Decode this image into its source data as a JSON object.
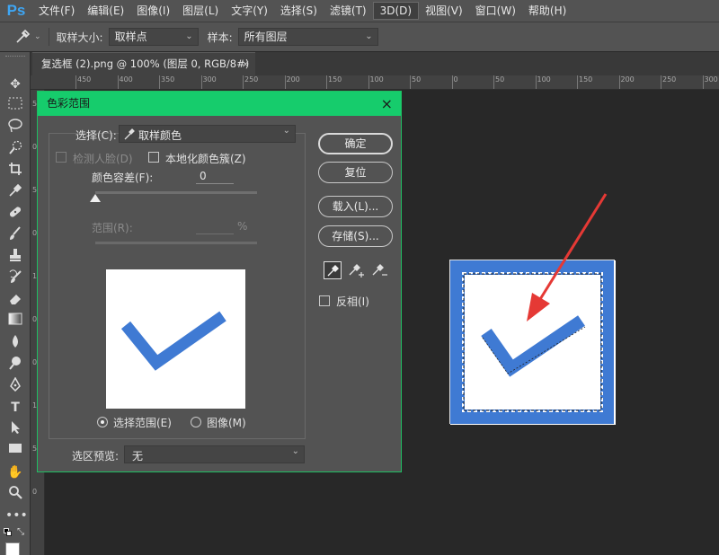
{
  "app": {
    "logo": "Ps",
    "accent": "#16cc6c"
  },
  "menu": [
    "文件(F)",
    "编辑(E)",
    "图像(I)",
    "图层(L)",
    "文字(Y)",
    "选择(S)",
    "滤镜(T)",
    "3D(D)",
    "视图(V)",
    "窗口(W)",
    "帮助(H)"
  ],
  "options": {
    "tool_icon": "eyedropper-icon",
    "sample_size_label": "取样大小:",
    "sample_size_value": "取样点",
    "sample_label": "样本:",
    "sample_value": "所有图层"
  },
  "document": {
    "tab_title": "复选框 (2).png @ 100% (图层 0, RGB/8#) *",
    "close": "×"
  },
  "ruler": {
    "top_ticks": [
      "450",
      "400",
      "350",
      "300",
      "250",
      "200",
      "150",
      "100",
      "50",
      "0",
      "50",
      "100",
      "150",
      "200",
      "250",
      "300",
      "350"
    ],
    "left_ticks": [
      "5",
      "0",
      "5",
      "0",
      "1",
      "0",
      "0",
      "1",
      "5",
      "0"
    ]
  },
  "dialog": {
    "title": "色彩范围",
    "close": "×",
    "select_label": "选择(C):",
    "select_value": "取样颜色",
    "detect_faces": "检测人脸(D)",
    "localized_clusters": "本地化颜色簇(Z)",
    "fuzziness_label": "颜色容差(F):",
    "fuzziness_value": "0",
    "range_label": "范围(R):",
    "range_unit": "%",
    "radio_selection": "选择范围(E)",
    "radio_image": "图像(M)",
    "preview_label": "选区预览:",
    "preview_value": "无",
    "buttons": {
      "ok": "确定",
      "reset": "复位",
      "load": "载入(L)...",
      "save": "存储(S)..."
    },
    "invert": "反相(I)"
  }
}
